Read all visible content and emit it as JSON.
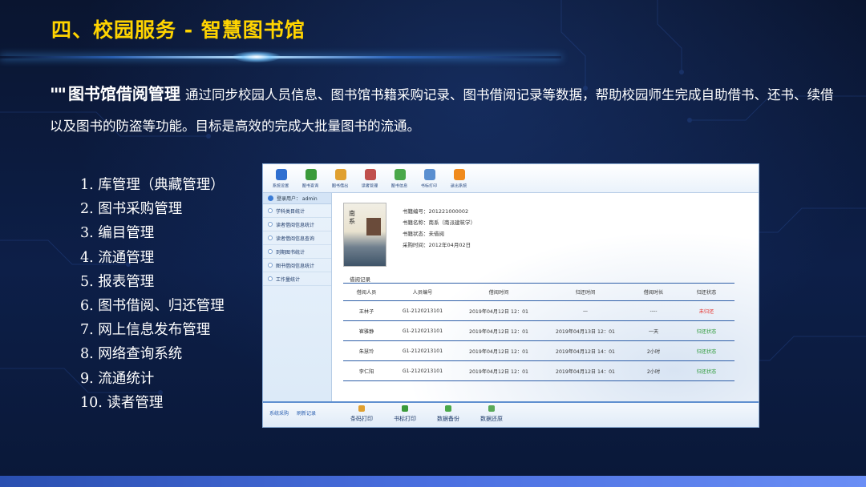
{
  "slide": {
    "title": "四、校园服务 - 智慧图书馆",
    "intro": {
      "quote_mark": "\"\"",
      "heading": "图书馆借阅管理",
      "text": "通过同步校园人员信息、图书馆书籍采购记录、图书借阅记录等数据，帮助校园师生完成自助借书、还书、续借以及图书的防盗等功能。目标是高效的完成大批量图书的流通。"
    },
    "features": [
      "1. 库管理（典藏管理）",
      "2. 图书采购管理",
      "3. 编目管理",
      "4. 流通管理",
      "5. 报表管理",
      "6. 图书借阅、归还管理",
      "7. 网上信息发布管理",
      "8. 网络查询系统",
      "9. 流通统计",
      "10. 读者管理"
    ]
  },
  "app": {
    "toolbar": [
      {
        "label": "系统设置",
        "icon": "gear-icon",
        "color": "#2f6fd0"
      },
      {
        "label": "图书查询",
        "icon": "search-icon",
        "color": "#3a9a3a"
      },
      {
        "label": "图书借出",
        "icon": "book-out-icon",
        "color": "#e0a030"
      },
      {
        "label": "读者管理",
        "icon": "reader-icon",
        "color": "#c0504d"
      },
      {
        "label": "图书信息",
        "icon": "book-info-icon",
        "color": "#4aa84a"
      },
      {
        "label": "书标打印",
        "icon": "printer-icon",
        "color": "#5a8fd0"
      },
      {
        "label": "退出系统",
        "icon": "exit-icon",
        "color": "#f08a1c"
      }
    ],
    "sidebar": {
      "login": "登录用户： admin",
      "items": [
        "学科类目统计",
        "读者借阅信息统计",
        "读者借阅信息查询",
        "到期图书统计",
        "图书借阅信息统计",
        "工作量统计"
      ]
    },
    "book": {
      "id": "书籍编号：201221000002",
      "name": "书籍名称：南系（南派建筑学）",
      "status": "书籍状态：未借阅",
      "purchase": "采购时间：2012年04月02日",
      "cover_text": "南系"
    },
    "records": {
      "title": "借阅记录",
      "headers": [
        "借阅人员",
        "人员编号",
        "借阅时间",
        "归还时间",
        "借阅时长",
        "归还状态"
      ],
      "rows": [
        {
          "name": "王林子",
          "id": "G1-2120213101",
          "borrow": "2019年04月12日 12：01",
          "return": "—",
          "duration": "----",
          "status": "未归还",
          "status_type": "red"
        },
        {
          "name": "崔雅静",
          "id": "G1-2120213101",
          "borrow": "2019年04月12日 12：01",
          "return": "2019年04月13日 12：01",
          "duration": "一天",
          "status": "归还状态",
          "status_type": "green"
        },
        {
          "name": "朱慧玲",
          "id": "G1-2120213101",
          "borrow": "2019年04月12日 12：01",
          "return": "2019年04月12日 14：01",
          "duration": "2小时",
          "status": "归还状态",
          "status_type": "green"
        },
        {
          "name": "李仁阳",
          "id": "G1-2120213101",
          "borrow": "2019年04月12日 12：01",
          "return": "2019年04月12日 14：01",
          "duration": "2小时",
          "status": "归还状态",
          "status_type": "green"
        }
      ]
    },
    "bottom": {
      "links": [
        "系统采购",
        "刷新记录"
      ],
      "buttons": [
        {
          "label": "条码打印",
          "icon": "barcode-print-icon",
          "color": "#e0a030"
        },
        {
          "label": "书标打印",
          "icon": "label-print-icon",
          "color": "#3a9a3a"
        },
        {
          "label": "数据备份",
          "icon": "backup-icon",
          "color": "#4aa84a"
        },
        {
          "label": "数据还原",
          "icon": "restore-icon",
          "color": "#5aaa5a"
        }
      ]
    }
  }
}
